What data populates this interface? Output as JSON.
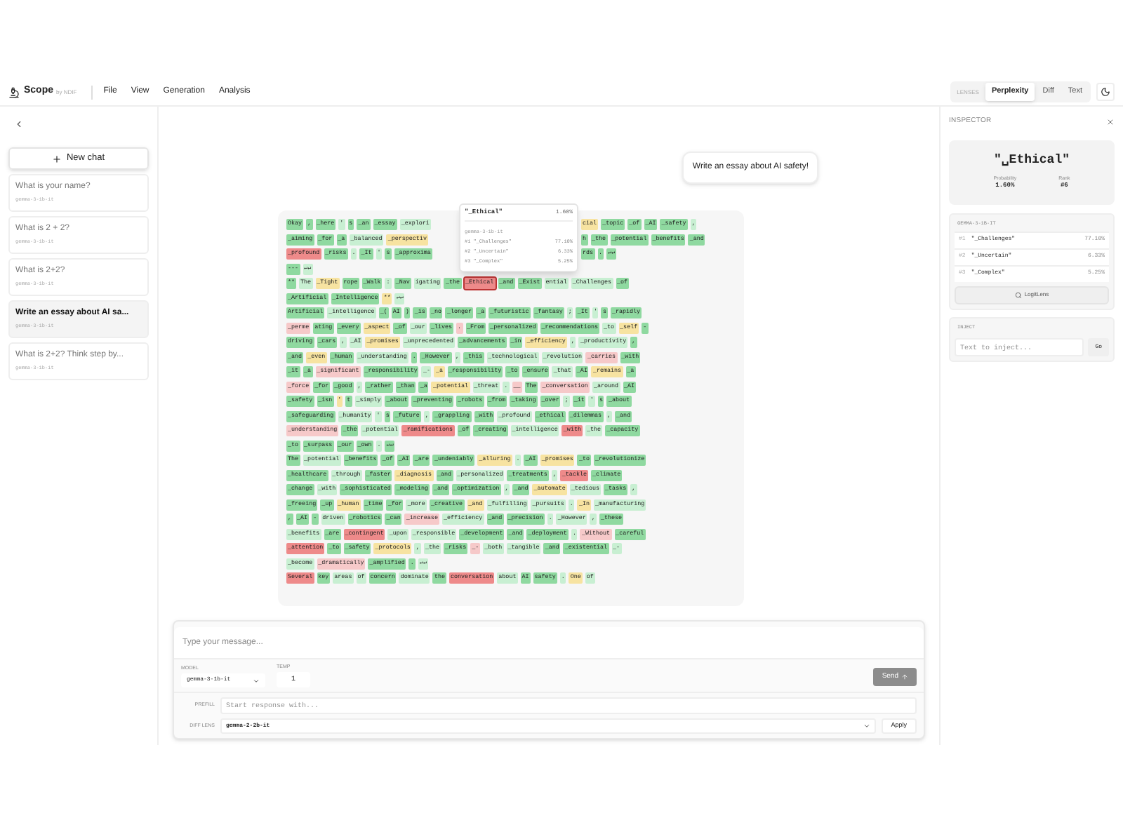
{
  "header": {
    "app_name": "Scope",
    "byline": "by NDIF",
    "menu": [
      "File",
      "View",
      "Generation",
      "Analysis"
    ],
    "lens_label": "LENSES",
    "lenses": [
      {
        "label": "Perplexity",
        "selected": true
      },
      {
        "label": "Diff",
        "selected": false
      },
      {
        "label": "Text",
        "selected": false
      }
    ]
  },
  "sidebar": {
    "new_chat": "New chat",
    "chats": [
      {
        "title": "What is your name?",
        "model": "gemma-3-1b-it",
        "selected": false
      },
      {
        "title": "What is 2 + 2?",
        "model": "gemma-3-1b-it",
        "selected": false
      },
      {
        "title": "What is 2+2?",
        "model": "gemma-3-1b-it",
        "selected": false
      },
      {
        "title": "Write an essay about AI sa...",
        "model": "gemma-3-1b-it",
        "selected": true
      },
      {
        "title": "What is 2+2? Think step by...",
        "model": "gemma-3-1b-it",
        "selected": false
      }
    ]
  },
  "user_message": "Write an essay about AI safety!",
  "tooltip": {
    "token": "\"_Ethical\"",
    "prob": "1.60%",
    "model": "gemma-3-1b-it",
    "alternatives": [
      {
        "rank": "#1",
        "token": "\"_Challenges\"",
        "prob": "77.10%"
      },
      {
        "rank": "#2",
        "token": "\"_Uncertain\"",
        "prob": "6.33%"
      },
      {
        "rank": "#3",
        "token": "\"_Complex\"",
        "prob": "5.25%"
      }
    ]
  },
  "rows": [
    {
      "tokens": [
        {
          "text": "Okay",
          "color": "#8fd9a0",
          "selected": false
        },
        {
          "text": ",",
          "color": "#8fd9a0",
          "selected": false
        },
        {
          "text": "_here",
          "color": "#8fd9a0",
          "selected": false
        },
        {
          "text": "'",
          "color": "#c8efd2",
          "selected": false
        },
        {
          "text": "s",
          "color": "#8fd9a0",
          "selected": false
        },
        {
          "text": "_an",
          "color": "#8fd9a0",
          "selected": false
        },
        {
          "text": "_essay",
          "color": "#8fd9a0",
          "selected": false
        },
        {
          "text": "_explori",
          "color": "#c8efd2",
          "selected": false
        }
      ],
      "after_tooltip": [
        {
          "text": "cial",
          "color": "#f7e3a1",
          "selected": false
        },
        {
          "text": "_topic",
          "color": "#8fd9a0",
          "selected": false
        },
        {
          "text": "_of",
          "color": "#8fd9a0",
          "selected": false
        },
        {
          "text": "_AI",
          "color": "#8fd9a0",
          "selected": false
        },
        {
          "text": "_safety",
          "color": "#8fd9a0",
          "selected": false
        },
        {
          "text": ",",
          "color": "#c8efd2",
          "selected": false
        }
      ]
    },
    {
      "tokens": [
        {
          "text": "_aiming",
          "color": "#8fd9a0",
          "selected": false
        },
        {
          "text": "_for",
          "color": "#8fd9a0",
          "selected": false
        },
        {
          "text": "_a",
          "color": "#8fd9a0",
          "selected": false
        },
        {
          "text": "_balanced",
          "color": "#c8efd2",
          "selected": false
        },
        {
          "text": "_perspectiv",
          "color": "#f7e3a1",
          "selected": false
        }
      ],
      "after_tooltip": [
        {
          "text": "h",
          "color": "#8fd9a0",
          "selected": false
        },
        {
          "text": "_the",
          "color": "#8fd9a0",
          "selected": false
        },
        {
          "text": "_potential",
          "color": "#8fd9a0",
          "selected": false
        },
        {
          "text": "_benefits",
          "color": "#8fd9a0",
          "selected": false
        },
        {
          "text": "_and",
          "color": "#8fd9a0",
          "selected": false
        }
      ]
    },
    {
      "tokens": [
        {
          "text": "_profound",
          "color": "#ee8a8a",
          "selected": false
        },
        {
          "text": "_risks",
          "color": "#8fd9a0",
          "selected": false
        },
        {
          "text": ".",
          "color": "#c8efd2",
          "selected": false
        },
        {
          "text": "_It",
          "color": "#8fd9a0",
          "selected": false
        },
        {
          "text": "'",
          "color": "#c8efd2",
          "selected": false
        },
        {
          "text": "s",
          "color": "#8fd9a0",
          "selected": false
        },
        {
          "text": "_approxima",
          "color": "#8fd9a0",
          "selected": false
        }
      ],
      "after_tooltip": [
        {
          "text": "rds",
          "color": "#8fd9a0",
          "selected": false
        },
        {
          "text": ".",
          "color": "#8fd9a0",
          "selected": false
        },
        {
          "text": "↵↵",
          "color": "#8fd9a0",
          "selected": false
        }
      ]
    },
    {
      "tokens": [
        {
          "text": "---",
          "color": "#8fd9a0",
          "selected": false
        },
        {
          "text": "↵↵",
          "color": "#c8efd2",
          "selected": false
        }
      ]
    },
    {
      "tokens": [
        {
          "text": "**",
          "color": "#8fd9a0",
          "selected": false
        },
        {
          "text": "The",
          "color": "#c8efd2",
          "selected": false
        },
        {
          "text": "_Tight",
          "color": "#f7e3a1",
          "selected": false
        },
        {
          "text": "rope",
          "color": "#8fd9a0",
          "selected": false
        },
        {
          "text": "_Walk",
          "color": "#8fd9a0",
          "selected": false
        },
        {
          "text": ":",
          "color": "#c8efd2",
          "selected": false
        },
        {
          "text": "_Nav",
          "color": "#8fd9a0",
          "selected": false
        },
        {
          "text": "igating",
          "color": "#c8efd2",
          "selected": false
        },
        {
          "text": "_the",
          "color": "#8fd9a0",
          "selected": false
        },
        {
          "text": "_Ethical",
          "color": "#ee8a8a",
          "selected": true
        },
        {
          "text": "_and",
          "color": "#8fd9a0",
          "selected": false
        },
        {
          "text": "_Exist",
          "color": "#8fd9a0",
          "selected": false
        },
        {
          "text": "ential",
          "color": "#c8efd2",
          "selected": false
        },
        {
          "text": "_Challenges",
          "color": "#c8efd2",
          "selected": false
        },
        {
          "text": "_of",
          "color": "#8fd9a0",
          "selected": false
        }
      ]
    },
    {
      "tokens": [
        {
          "text": "_Artificial",
          "color": "#8fd9a0",
          "selected": false
        },
        {
          "text": "_Intelligence",
          "color": "#8fd9a0",
          "selected": false
        },
        {
          "text": "**",
          "color": "#f7e3a1",
          "selected": false
        },
        {
          "text": "↵↵",
          "color": "#c8efd2",
          "selected": false
        }
      ]
    },
    {
      "tokens": [
        {
          "text": "Artificial",
          "color": "#8fd9a0",
          "selected": false
        },
        {
          "text": "_intelligence",
          "color": "#c8efd2",
          "selected": false
        },
        {
          "text": "_(",
          "color": "#8fd9a0",
          "selected": false
        },
        {
          "text": "AI",
          "color": "#8fd9a0",
          "selected": false
        },
        {
          "text": ")",
          "color": "#8fd9a0",
          "selected": false
        },
        {
          "text": "_is",
          "color": "#8fd9a0",
          "selected": false
        },
        {
          "text": "_no",
          "color": "#8fd9a0",
          "selected": false
        },
        {
          "text": "_longer",
          "color": "#8fd9a0",
          "selected": false
        },
        {
          "text": "_a",
          "color": "#8fd9a0",
          "selected": false
        },
        {
          "text": "_futuristic",
          "color": "#8fd9a0",
          "selected": false
        },
        {
          "text": "_fantasy",
          "color": "#8fd9a0",
          "selected": false
        },
        {
          "text": ";",
          "color": "#c8efd2",
          "selected": false
        },
        {
          "text": "_It",
          "color": "#8fd9a0",
          "selected": false
        },
        {
          "text": "'",
          "color": "#c8efd2",
          "selected": false
        },
        {
          "text": "s",
          "color": "#8fd9a0",
          "selected": false
        },
        {
          "text": "_rapidly",
          "color": "#8fd9a0",
          "selected": false
        }
      ]
    },
    {
      "tokens": [
        {
          "text": "_perme",
          "color": "#f6c9c9",
          "selected": false
        },
        {
          "text": "ating",
          "color": "#8fd9a0",
          "selected": false
        },
        {
          "text": "_every",
          "color": "#8fd9a0",
          "selected": false
        },
        {
          "text": "_aspect",
          "color": "#f7e3a1",
          "selected": false
        },
        {
          "text": "_of",
          "color": "#8fd9a0",
          "selected": false
        },
        {
          "text": "_our",
          "color": "#c8efd2",
          "selected": false
        },
        {
          "text": "_lives",
          "color": "#8fd9a0",
          "selected": false
        },
        {
          "text": ".",
          "color": "#f6c9c9",
          "selected": false
        },
        {
          "text": "_From",
          "color": "#8fd9a0",
          "selected": false
        },
        {
          "text": "_personalized",
          "color": "#8fd9a0",
          "selected": false
        },
        {
          "text": "_recommendations",
          "color": "#8fd9a0",
          "selected": false
        },
        {
          "text": "_to",
          "color": "#c8efd2",
          "selected": false
        },
        {
          "text": "_self",
          "color": "#f7e3a1",
          "selected": false
        },
        {
          "text": "-",
          "color": "#8fd9a0",
          "selected": false
        }
      ]
    },
    {
      "tokens": [
        {
          "text": "driving",
          "color": "#8fd9a0",
          "selected": false
        },
        {
          "text": "_cars",
          "color": "#8fd9a0",
          "selected": false
        },
        {
          "text": ",",
          "color": "#c8efd2",
          "selected": false
        },
        {
          "text": "_AI",
          "color": "#c8efd2",
          "selected": false
        },
        {
          "text": "_promises",
          "color": "#f7e3a1",
          "selected": false
        },
        {
          "text": "_unprecedented",
          "color": "#c8efd2",
          "selected": false
        },
        {
          "text": "_advancements",
          "color": "#8fd9a0",
          "selected": false
        },
        {
          "text": "_in",
          "color": "#8fd9a0",
          "selected": false
        },
        {
          "text": "_efficiency",
          "color": "#f7e3a1",
          "selected": false
        },
        {
          "text": ",",
          "color": "#c8efd2",
          "selected": false
        },
        {
          "text": "_productivity",
          "color": "#c8efd2",
          "selected": false
        },
        {
          "text": ",",
          "color": "#8fd9a0",
          "selected": false
        }
      ]
    },
    {
      "tokens": [
        {
          "text": "_and",
          "color": "#8fd9a0",
          "selected": false
        },
        {
          "text": "_even",
          "color": "#f7e3a1",
          "selected": false
        },
        {
          "text": "_human",
          "color": "#8fd9a0",
          "selected": false
        },
        {
          "text": "_understanding",
          "color": "#c8efd2",
          "selected": false
        },
        {
          "text": ".",
          "color": "#8fd9a0",
          "selected": false
        },
        {
          "text": "_However",
          "color": "#8fd9a0",
          "selected": false
        },
        {
          "text": ",",
          "color": "#c8efd2",
          "selected": false
        },
        {
          "text": "_this",
          "color": "#8fd9a0",
          "selected": false
        },
        {
          "text": "_technological",
          "color": "#c8efd2",
          "selected": false
        },
        {
          "text": "_revolution",
          "color": "#c8efd2",
          "selected": false
        },
        {
          "text": "_carries",
          "color": "#f6c9c9",
          "selected": false
        },
        {
          "text": "_with",
          "color": "#8fd9a0",
          "selected": false
        }
      ]
    },
    {
      "tokens": [
        {
          "text": "_it",
          "color": "#8fd9a0",
          "selected": false
        },
        {
          "text": "_a",
          "color": "#8fd9a0",
          "selected": false
        },
        {
          "text": "_significant",
          "color": "#f6c9c9",
          "selected": false
        },
        {
          "text": "_responsibility",
          "color": "#8fd9a0",
          "selected": false
        },
        {
          "text": "_-",
          "color": "#c8efd2",
          "selected": false
        },
        {
          "text": "_a",
          "color": "#f7e3a1",
          "selected": false
        },
        {
          "text": "_responsibility",
          "color": "#8fd9a0",
          "selected": false
        },
        {
          "text": "_to",
          "color": "#8fd9a0",
          "selected": false
        },
        {
          "text": "_ensure",
          "color": "#8fd9a0",
          "selected": false
        },
        {
          "text": "_that",
          "color": "#c8efd2",
          "selected": false
        },
        {
          "text": "_AI",
          "color": "#8fd9a0",
          "selected": false
        },
        {
          "text": "_remains",
          "color": "#f7e3a1",
          "selected": false
        },
        {
          "text": "_a",
          "color": "#8fd9a0",
          "selected": false
        }
      ]
    },
    {
      "tokens": [
        {
          "text": "_force",
          "color": "#f6c9c9",
          "selected": false
        },
        {
          "text": "_for",
          "color": "#8fd9a0",
          "selected": false
        },
        {
          "text": "_good",
          "color": "#8fd9a0",
          "selected": false
        },
        {
          "text": ",",
          "color": "#c8efd2",
          "selected": false
        },
        {
          "text": "_rather",
          "color": "#8fd9a0",
          "selected": false
        },
        {
          "text": "_than",
          "color": "#8fd9a0",
          "selected": false
        },
        {
          "text": "_a",
          "color": "#8fd9a0",
          "selected": false
        },
        {
          "text": "_potential",
          "color": "#f7e3a1",
          "selected": false
        },
        {
          "text": "_threat",
          "color": "#c8efd2",
          "selected": false
        },
        {
          "text": ".",
          "color": "#c8efd2",
          "selected": false
        },
        {
          "text": "__",
          "color": "#f6c9c9",
          "selected": false
        },
        {
          "text": "The",
          "color": "#8fd9a0",
          "selected": false
        },
        {
          "text": "_conversation",
          "color": "#f6c9c9",
          "selected": false
        },
        {
          "text": "_around",
          "color": "#c8efd2",
          "selected": false
        },
        {
          "text": "_AI",
          "color": "#8fd9a0",
          "selected": false
        }
      ]
    },
    {
      "tokens": [
        {
          "text": "_safety",
          "color": "#8fd9a0",
          "selected": false
        },
        {
          "text": "_isn",
          "color": "#8fd9a0",
          "selected": false
        },
        {
          "text": "'",
          "color": "#f7e3a1",
          "selected": false
        },
        {
          "text": "t",
          "color": "#8fd9a0",
          "selected": false
        },
        {
          "text": "_simply",
          "color": "#c8efd2",
          "selected": false
        },
        {
          "text": "_about",
          "color": "#8fd9a0",
          "selected": false
        },
        {
          "text": "_preventing",
          "color": "#8fd9a0",
          "selected": false
        },
        {
          "text": "_robots",
          "color": "#8fd9a0",
          "selected": false
        },
        {
          "text": "_from",
          "color": "#8fd9a0",
          "selected": false
        },
        {
          "text": "_taking",
          "color": "#8fd9a0",
          "selected": false
        },
        {
          "text": "_over",
          "color": "#8fd9a0",
          "selected": false
        },
        {
          "text": ";",
          "color": "#c8efd2",
          "selected": false
        },
        {
          "text": "_it",
          "color": "#8fd9a0",
          "selected": false
        },
        {
          "text": "'",
          "color": "#c8efd2",
          "selected": false
        },
        {
          "text": "s",
          "color": "#8fd9a0",
          "selected": false
        },
        {
          "text": "_about",
          "color": "#8fd9a0",
          "selected": false
        }
      ]
    },
    {
      "tokens": [
        {
          "text": "_safeguarding",
          "color": "#8fd9a0",
          "selected": false
        },
        {
          "text": "_humanity",
          "color": "#c8efd2",
          "selected": false
        },
        {
          "text": "'",
          "color": "#c8efd2",
          "selected": false
        },
        {
          "text": "s",
          "color": "#8fd9a0",
          "selected": false
        },
        {
          "text": "_future",
          "color": "#8fd9a0",
          "selected": false
        },
        {
          "text": ",",
          "color": "#c8efd2",
          "selected": false
        },
        {
          "text": "_grappling",
          "color": "#8fd9a0",
          "selected": false
        },
        {
          "text": "_with",
          "color": "#8fd9a0",
          "selected": false
        },
        {
          "text": "_profound",
          "color": "#c8efd2",
          "selected": false
        },
        {
          "text": "_ethical",
          "color": "#8fd9a0",
          "selected": false
        },
        {
          "text": "_dilemmas",
          "color": "#8fd9a0",
          "selected": false
        },
        {
          "text": ",",
          "color": "#c8efd2",
          "selected": false
        },
        {
          "text": "_and",
          "color": "#8fd9a0",
          "selected": false
        }
      ]
    },
    {
      "tokens": [
        {
          "text": "_understanding",
          "color": "#f6c9c9",
          "selected": false
        },
        {
          "text": "_the",
          "color": "#8fd9a0",
          "selected": false
        },
        {
          "text": "_potential",
          "color": "#c8efd2",
          "selected": false
        },
        {
          "text": "_ramifications",
          "color": "#ee8a8a",
          "selected": false
        },
        {
          "text": "_of",
          "color": "#8fd9a0",
          "selected": false
        },
        {
          "text": "_creating",
          "color": "#8fd9a0",
          "selected": false
        },
        {
          "text": "_intelligence",
          "color": "#c8efd2",
          "selected": false
        },
        {
          "text": "_with",
          "color": "#ee8a8a",
          "selected": false
        },
        {
          "text": "_the",
          "color": "#c8efd2",
          "selected": false
        },
        {
          "text": "_capacity",
          "color": "#8fd9a0",
          "selected": false
        }
      ]
    },
    {
      "tokens": [
        {
          "text": "_to",
          "color": "#8fd9a0",
          "selected": false
        },
        {
          "text": "_surpass",
          "color": "#8fd9a0",
          "selected": false
        },
        {
          "text": "_our",
          "color": "#8fd9a0",
          "selected": false
        },
        {
          "text": "_own",
          "color": "#8fd9a0",
          "selected": false
        },
        {
          "text": ".",
          "color": "#c8efd2",
          "selected": false
        },
        {
          "text": "↵↵",
          "color": "#8fd9a0",
          "selected": false
        }
      ]
    },
    {
      "tokens": [
        {
          "text": "The",
          "color": "#8fd9a0",
          "selected": false
        },
        {
          "text": "_potential",
          "color": "#c8efd2",
          "selected": false
        },
        {
          "text": "_benefits",
          "color": "#8fd9a0",
          "selected": false
        },
        {
          "text": "_of",
          "color": "#8fd9a0",
          "selected": false
        },
        {
          "text": "_AI",
          "color": "#8fd9a0",
          "selected": false
        },
        {
          "text": "_are",
          "color": "#8fd9a0",
          "selected": false
        },
        {
          "text": "_undeniably",
          "color": "#8fd9a0",
          "selected": false
        },
        {
          "text": "_alluring",
          "color": "#f7e3a1",
          "selected": false
        },
        {
          "text": ".",
          "color": "#c8efd2",
          "selected": false
        },
        {
          "text": "_AI",
          "color": "#8fd9a0",
          "selected": false
        },
        {
          "text": "_promises",
          "color": "#f7e3a1",
          "selected": false
        },
        {
          "text": "_to",
          "color": "#8fd9a0",
          "selected": false
        },
        {
          "text": "_revolutionize",
          "color": "#8fd9a0",
          "selected": false
        }
      ]
    },
    {
      "tokens": [
        {
          "text": "_healthcare",
          "color": "#8fd9a0",
          "selected": false
        },
        {
          "text": "_through",
          "color": "#c8efd2",
          "selected": false
        },
        {
          "text": "_faster",
          "color": "#8fd9a0",
          "selected": false
        },
        {
          "text": "_diagnosis",
          "color": "#f7e3a1",
          "selected": false
        },
        {
          "text": "_and",
          "color": "#8fd9a0",
          "selected": false
        },
        {
          "text": "_personalized",
          "color": "#c8efd2",
          "selected": false
        },
        {
          "text": "_treatments",
          "color": "#8fd9a0",
          "selected": false
        },
        {
          "text": ",",
          "color": "#c8efd2",
          "selected": false
        },
        {
          "text": "_tackle",
          "color": "#ee8a8a",
          "selected": false
        },
        {
          "text": "_climate",
          "color": "#8fd9a0",
          "selected": false
        }
      ]
    },
    {
      "tokens": [
        {
          "text": "_change",
          "color": "#8fd9a0",
          "selected": false
        },
        {
          "text": "_with",
          "color": "#c8efd2",
          "selected": false
        },
        {
          "text": "_sophisticated",
          "color": "#8fd9a0",
          "selected": false
        },
        {
          "text": "_modeling",
          "color": "#8fd9a0",
          "selected": false
        },
        {
          "text": "_and",
          "color": "#8fd9a0",
          "selected": false
        },
        {
          "text": "_optimization",
          "color": "#8fd9a0",
          "selected": false
        },
        {
          "text": ",",
          "color": "#c8efd2",
          "selected": false
        },
        {
          "text": "_and",
          "color": "#8fd9a0",
          "selected": false
        },
        {
          "text": "_automate",
          "color": "#f7e3a1",
          "selected": false
        },
        {
          "text": "_tedious",
          "color": "#c8efd2",
          "selected": false
        },
        {
          "text": "_tasks",
          "color": "#8fd9a0",
          "selected": false
        },
        {
          "text": ",",
          "color": "#c8efd2",
          "selected": false
        }
      ]
    },
    {
      "tokens": [
        {
          "text": "_freeing",
          "color": "#8fd9a0",
          "selected": false
        },
        {
          "text": "_up",
          "color": "#8fd9a0",
          "selected": false
        },
        {
          "text": "_human",
          "color": "#f7e3a1",
          "selected": false
        },
        {
          "text": "_time",
          "color": "#8fd9a0",
          "selected": false
        },
        {
          "text": "_for",
          "color": "#8fd9a0",
          "selected": false
        },
        {
          "text": "_more",
          "color": "#c8efd2",
          "selected": false
        },
        {
          "text": "_creative",
          "color": "#8fd9a0",
          "selected": false
        },
        {
          "text": "_and",
          "color": "#f7e3a1",
          "selected": false
        },
        {
          "text": "_fulfilling",
          "color": "#c8efd2",
          "selected": false
        },
        {
          "text": "_pursuits",
          "color": "#c8efd2",
          "selected": false
        },
        {
          "text": ".",
          "color": "#c8efd2",
          "selected": false
        },
        {
          "text": "_In",
          "color": "#f7e3a1",
          "selected": false
        },
        {
          "text": "_manufacturing",
          "color": "#c8efd2",
          "selected": false
        }
      ]
    },
    {
      "tokens": [
        {
          "text": ",",
          "color": "#8fd9a0",
          "selected": false
        },
        {
          "text": "_AI",
          "color": "#8fd9a0",
          "selected": false
        },
        {
          "text": "-",
          "color": "#8fd9a0",
          "selected": false
        },
        {
          "text": "driven",
          "color": "#c8efd2",
          "selected": false
        },
        {
          "text": "_robotics",
          "color": "#8fd9a0",
          "selected": false
        },
        {
          "text": "_can",
          "color": "#8fd9a0",
          "selected": false
        },
        {
          "text": "_increase",
          "color": "#f6c9c9",
          "selected": false
        },
        {
          "text": "_efficiency",
          "color": "#c8efd2",
          "selected": false
        },
        {
          "text": "_and",
          "color": "#8fd9a0",
          "selected": false
        },
        {
          "text": "_precision",
          "color": "#8fd9a0",
          "selected": false
        },
        {
          "text": ".",
          "color": "#c8efd2",
          "selected": false
        },
        {
          "text": "_However",
          "color": "#c8efd2",
          "selected": false
        },
        {
          "text": ",",
          "color": "#c8efd2",
          "selected": false
        },
        {
          "text": "_these",
          "color": "#8fd9a0",
          "selected": false
        }
      ]
    },
    {
      "tokens": [
        {
          "text": "_benefits",
          "color": "#c8efd2",
          "selected": false
        },
        {
          "text": "_are",
          "color": "#8fd9a0",
          "selected": false
        },
        {
          "text": "_contingent",
          "color": "#ee8a8a",
          "selected": false
        },
        {
          "text": "_upon",
          "color": "#c8efd2",
          "selected": false
        },
        {
          "text": "_responsible",
          "color": "#c8efd2",
          "selected": false
        },
        {
          "text": "_development",
          "color": "#8fd9a0",
          "selected": false
        },
        {
          "text": "_and",
          "color": "#8fd9a0",
          "selected": false
        },
        {
          "text": "_deployment",
          "color": "#8fd9a0",
          "selected": false
        },
        {
          "text": ".",
          "color": "#c8efd2",
          "selected": false
        },
        {
          "text": "_Without",
          "color": "#f6c9c9",
          "selected": false
        },
        {
          "text": "_careful",
          "color": "#8fd9a0",
          "selected": false
        }
      ]
    },
    {
      "tokens": [
        {
          "text": "_attention",
          "color": "#ee8a8a",
          "selected": false
        },
        {
          "text": "_to",
          "color": "#8fd9a0",
          "selected": false
        },
        {
          "text": "_safety",
          "color": "#8fd9a0",
          "selected": false
        },
        {
          "text": "_protocols",
          "color": "#f7e3a1",
          "selected": false
        },
        {
          "text": ",",
          "color": "#c8efd2",
          "selected": false
        },
        {
          "text": "_the",
          "color": "#c8efd2",
          "selected": false
        },
        {
          "text": "_risks",
          "color": "#8fd9a0",
          "selected": false
        },
        {
          "text": "_-",
          "color": "#f6c9c9",
          "selected": false
        },
        {
          "text": "_both",
          "color": "#c8efd2",
          "selected": false
        },
        {
          "text": "_tangible",
          "color": "#c8efd2",
          "selected": false
        },
        {
          "text": "_and",
          "color": "#8fd9a0",
          "selected": false
        },
        {
          "text": "_existential",
          "color": "#8fd9a0",
          "selected": false
        },
        {
          "text": "_-",
          "color": "#c8efd2",
          "selected": false
        }
      ]
    },
    {
      "tokens": [
        {
          "text": "_become",
          "color": "#c8efd2",
          "selected": false
        },
        {
          "text": "_dramatically",
          "color": "#f6c9c9",
          "selected": false
        },
        {
          "text": "_amplified",
          "color": "#8fd9a0",
          "selected": false
        },
        {
          "text": ".",
          "color": "#8fd9a0",
          "selected": false
        },
        {
          "text": "↵↵",
          "color": "#c8efd2",
          "selected": false
        }
      ]
    },
    {
      "tokens": [
        {
          "text": "Several",
          "color": "#ee8a8a",
          "selected": false
        },
        {
          "text": "key",
          "color": "#8fd9a0",
          "selected": false
        },
        {
          "text": "areas",
          "color": "#c8efd2",
          "selected": false
        },
        {
          "text": "of",
          "color": "#c8efd2",
          "selected": false
        },
        {
          "text": "concern",
          "color": "#8fd9a0",
          "selected": false
        },
        {
          "text": "dominate",
          "color": "#c8efd2",
          "selected": false
        },
        {
          "text": "the",
          "color": "#8fd9a0",
          "selected": false
        },
        {
          "text": "conversation",
          "color": "#ee8a8a",
          "selected": false
        },
        {
          "text": "about",
          "color": "#c8efd2",
          "selected": false
        },
        {
          "text": "AI",
          "color": "#8fd9a0",
          "selected": false
        },
        {
          "text": "safety",
          "color": "#8fd9a0",
          "selected": false
        },
        {
          "text": ".",
          "color": "#c8efd2",
          "selected": false
        },
        {
          "text": "One",
          "color": "#f7e3a1",
          "selected": false
        },
        {
          "text": "of",
          "color": "#c8efd2",
          "selected": false
        }
      ]
    }
  ],
  "composer": {
    "placeholder": "Type your message...",
    "model_label": "MODEL",
    "model": "gemma-3-1b-it",
    "temp_label": "TEMP",
    "temp": "1",
    "send": "Send",
    "prefill_label": "PREFILL",
    "prefill_placeholder": "Start response with...",
    "diff_label": "DIFF LENS",
    "diff_model": "gemma-2-2b-it",
    "apply": "Apply"
  },
  "inspector": {
    "title": "INSPECTOR",
    "token": "\"␣Ethical\"",
    "prob_label": "Probability",
    "prob": "1.60%",
    "rank_label": "Rank",
    "rank": "#6",
    "model": "GEMMA-3-1B-IT",
    "alternatives": [
      {
        "rank": "#1",
        "token": "\"_Challenges\"",
        "prob": "77.10%"
      },
      {
        "rank": "#2",
        "token": "\"_Uncertain\"",
        "prob": "6.33%"
      },
      {
        "rank": "#3",
        "token": "\"_Complex\"",
        "prob": "5.25%"
      }
    ],
    "logitlens": "LogitLens",
    "inject_label": "INJECT",
    "inject_placeholder": "Text to inject...",
    "go": "Go"
  }
}
